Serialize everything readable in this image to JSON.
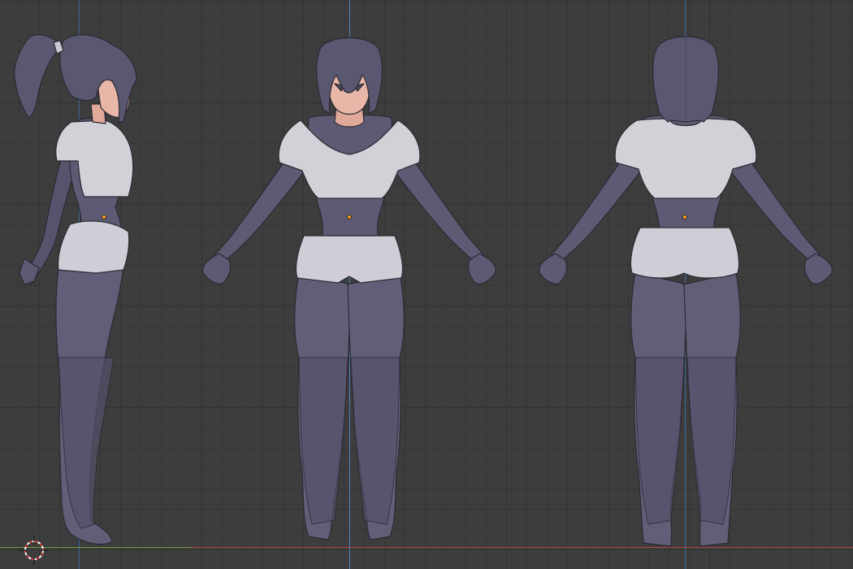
{
  "viewport": {
    "background": "#3d3d3d",
    "grid_minor_color": "#363636",
    "grid_major_color": "#333333",
    "axis_z_color": "#4a7fb8",
    "axis_x_color": "#b54545",
    "axis_y_color": "#6f9b3a",
    "origin_color": "#ff9e19"
  },
  "views": [
    {
      "name": "side-view",
      "label": ""
    },
    {
      "name": "front-view",
      "label": ""
    },
    {
      "name": "back-view",
      "label": ""
    }
  ],
  "icons": {
    "cursor": "3d-cursor-icon",
    "origin": "object-origin-icon"
  },
  "character": {
    "hair_color": "#5a5770",
    "bodysuit_color": "#5e5a74",
    "clothing_color": "#d3d1d8",
    "skin_color": "#e8b7a8"
  }
}
